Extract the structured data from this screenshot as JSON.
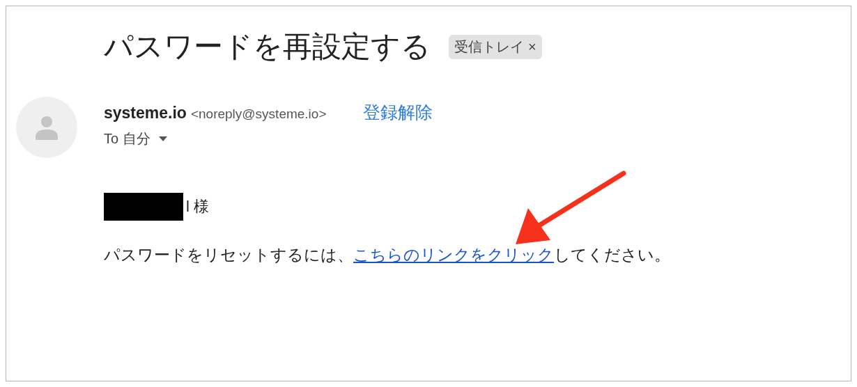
{
  "email": {
    "subject": "パスワードを再設定する",
    "label_chip": {
      "text": "受信トレイ",
      "close": "×"
    },
    "sender": {
      "name": "systeme.io",
      "address": "<noreply@systeme.io>",
      "unsubscribe": "登録解除"
    },
    "recipient": {
      "text": "To 自分"
    },
    "greeting": {
      "redacted": true,
      "text": "l 様"
    },
    "body": {
      "before": "パスワードをリセットするには、",
      "link": "こちらのリンクをクリック",
      "after": "してください。"
    }
  }
}
